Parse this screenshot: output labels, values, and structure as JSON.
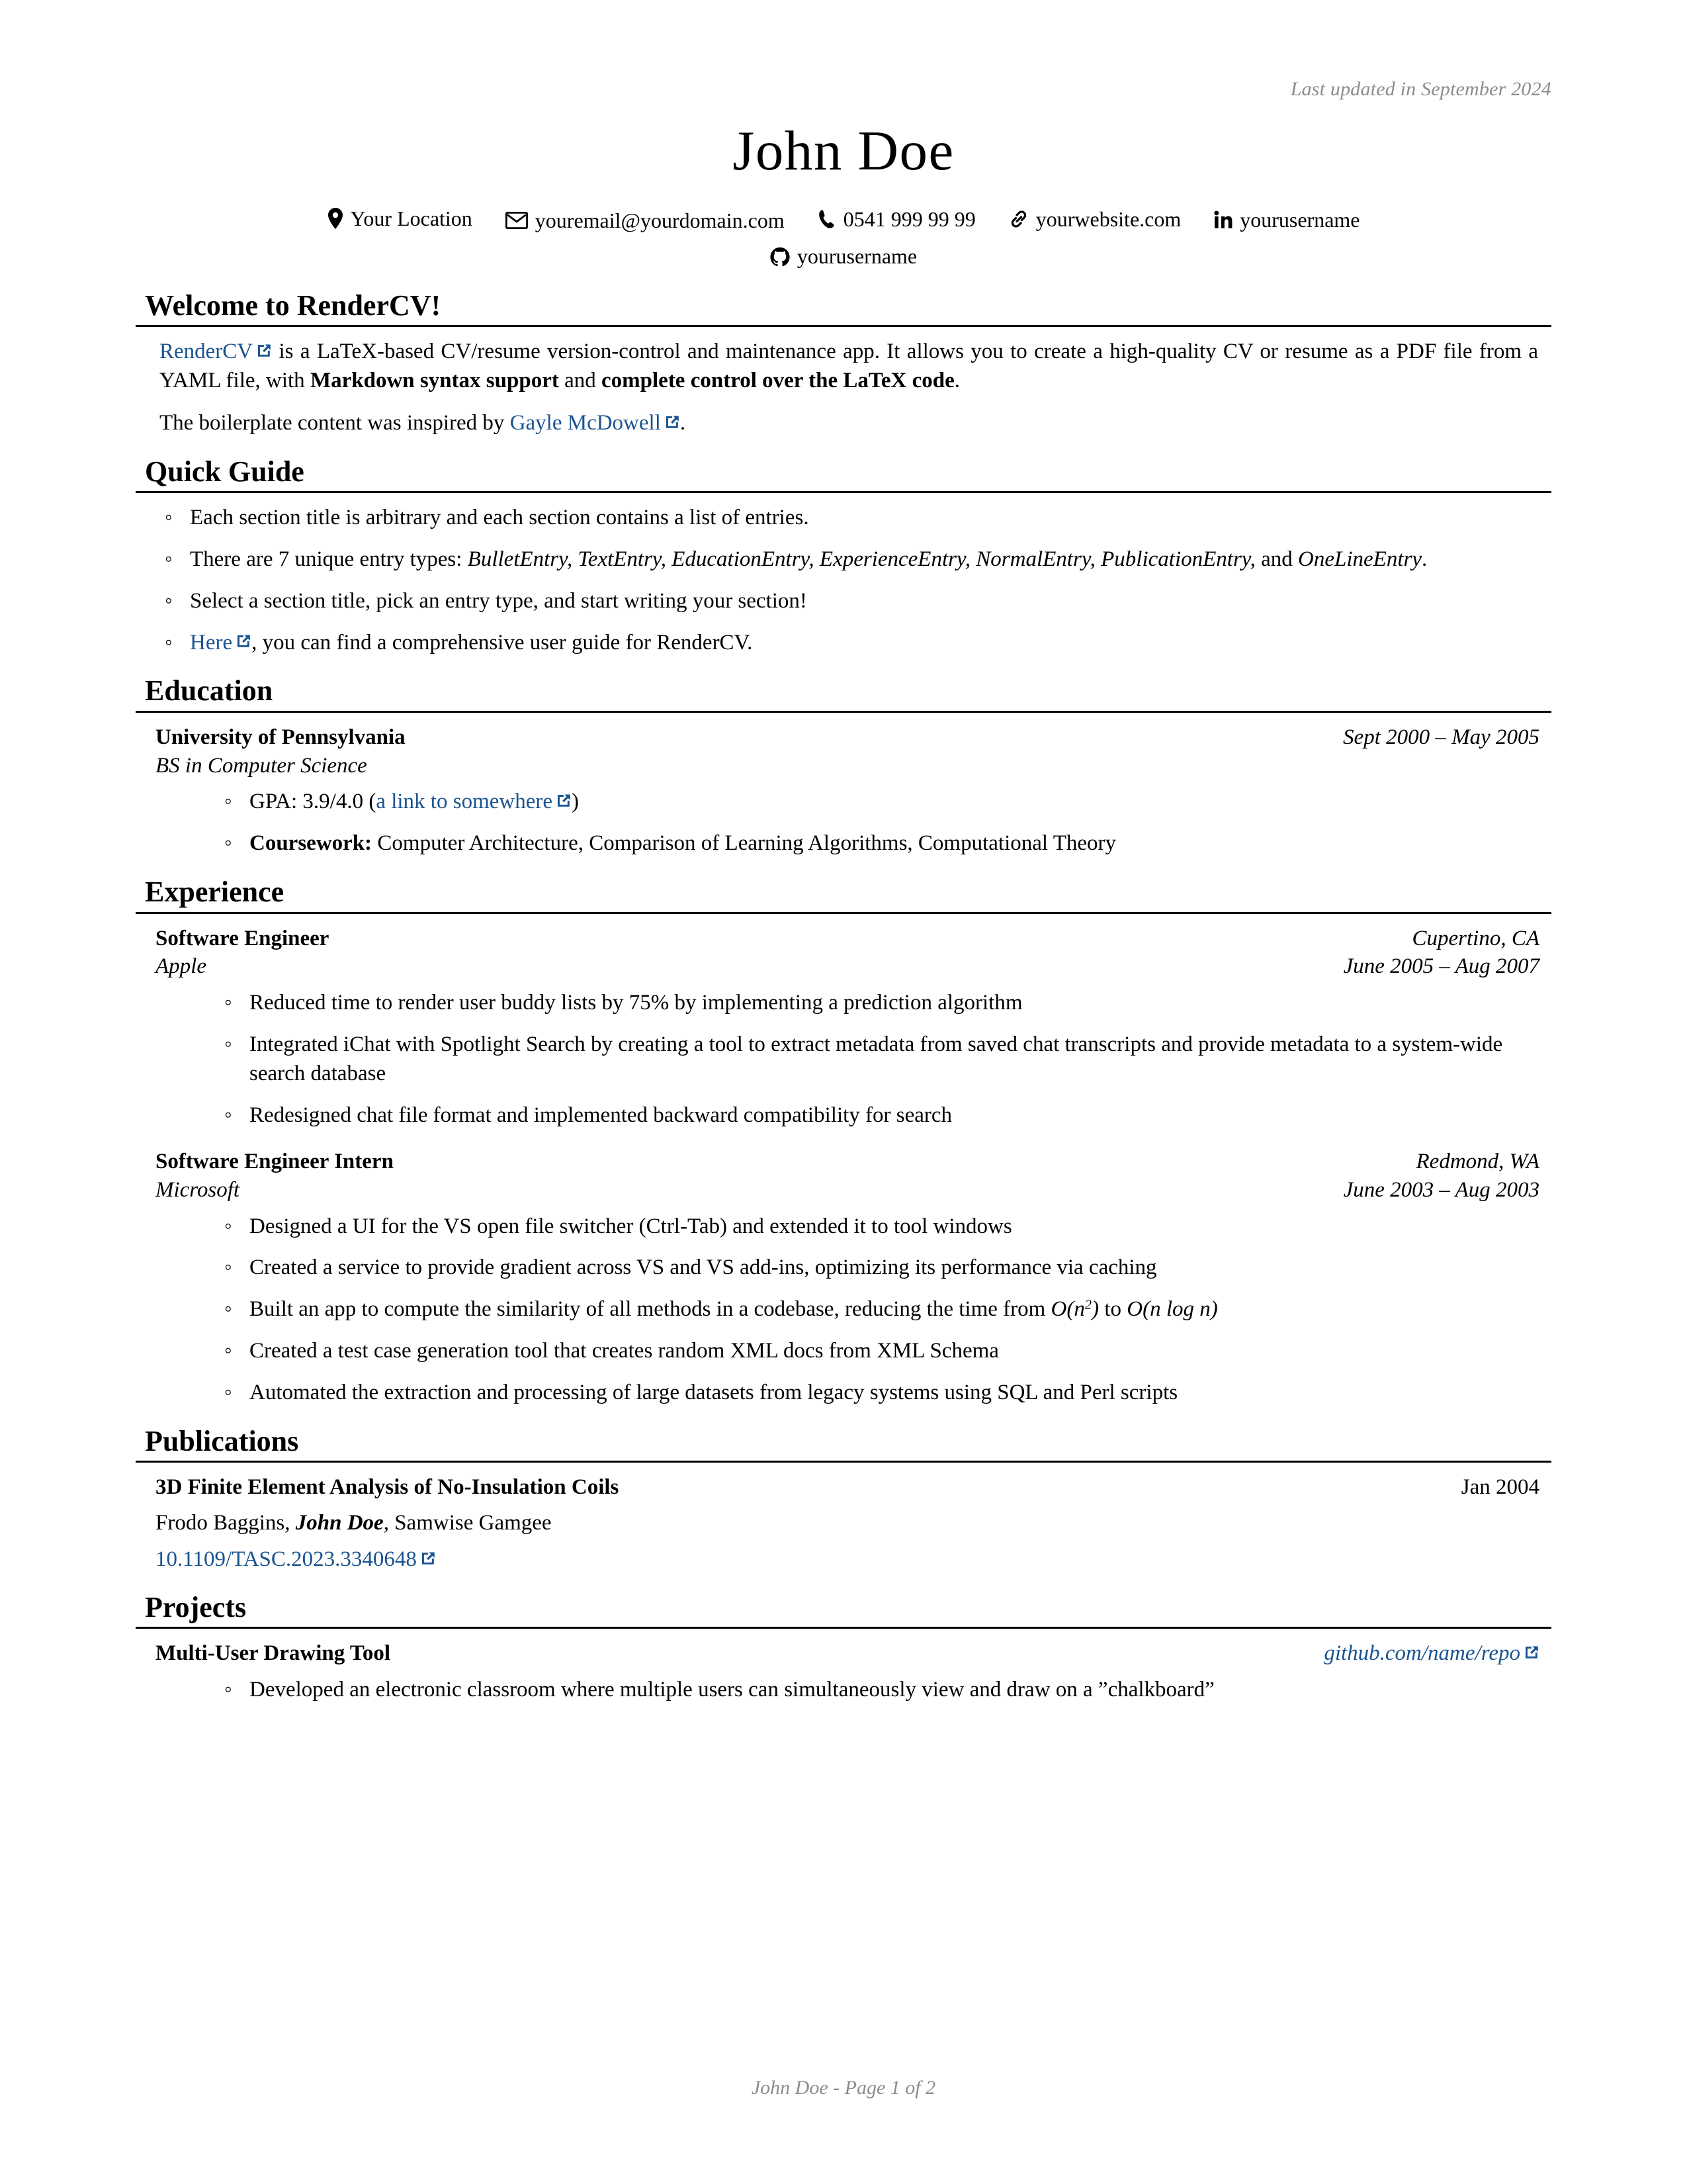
{
  "header": {
    "last_updated": "Last updated in September 2024",
    "name": "John Doe",
    "contacts": [
      {
        "icon": "location-pin-icon",
        "text": "Your Location"
      },
      {
        "icon": "envelope-icon",
        "text": "youremail@yourdomain.com"
      },
      {
        "icon": "phone-icon",
        "text": "0541 999 99 99"
      },
      {
        "icon": "link-icon",
        "text": "yourwebsite.com"
      },
      {
        "icon": "linkedin-icon",
        "text": "yourusername"
      },
      {
        "icon": "github-icon",
        "text": "yourusername"
      }
    ]
  },
  "welcome": {
    "title": "Welcome to RenderCV!",
    "p1_link": "RenderCV",
    "p1_part1": " is a LaTeX-based CV/resume version-control and maintenance app. It allows you to create a high-quality CV or resume as a PDF file from a YAML file, with ",
    "p1_bold1": "Markdown syntax support",
    "p1_part2": " and ",
    "p1_bold2": "complete control over the LaTeX code",
    "p1_part3": ".",
    "p2_part1": "The boilerplate content was inspired by ",
    "p2_link": "Gayle McDowell",
    "p2_part2": "."
  },
  "quick_guide": {
    "title": "Quick Guide",
    "item1": "Each section title is arbitrary and each section contains a list of entries.",
    "item2_part1": "There are 7 unique entry types: ",
    "item2_types": "BulletEntry, TextEntry, EducationEntry, ExperienceEntry, NormalEntry,",
    "item2_types2": "PublicationEntry,",
    "item2_and": " and ",
    "item2_types3": "OneLineEntry",
    "item2_end": ".",
    "item3": "Select a section title, pick an entry type, and start writing your section!",
    "item4_link": "Here",
    "item4_text": ", you can find a comprehensive user guide for RenderCV."
  },
  "education": {
    "title": "Education",
    "entries": [
      {
        "institution": "University of Pennsylvania",
        "dates": "Sept 2000 – May 2005",
        "degree": "BS in Computer Science",
        "gpa_label": "GPA: 3.9/4.0 (",
        "gpa_link": "a link to somewhere",
        "gpa_close": ")",
        "coursework_label": "Coursework:",
        "coursework_text": " Computer Architecture, Comparison of Learning Algorithms, Computational Theory"
      }
    ]
  },
  "experience": {
    "title": "Experience",
    "entries": [
      {
        "position": "Software Engineer",
        "location": "Cupertino, CA",
        "company": "Apple",
        "dates": "June 2005 – Aug 2007",
        "highlights": [
          "Reduced time to render user buddy lists by 75% by implementing a prediction algorithm",
          "Integrated iChat with Spotlight Search by creating a tool to extract metadata from saved chat transcripts and provide metadata to a system-wide search database",
          "Redesigned chat file format and implemented backward compatibility for search"
        ]
      },
      {
        "position": "Software Engineer Intern",
        "location": "Redmond, WA",
        "company": "Microsoft",
        "dates": "June 2003 – Aug 2003",
        "highlights": [
          "Designed a UI for the VS open file switcher (Ctrl-Tab) and extended it to tool windows",
          "Created a service to provide gradient across VS and VS add-ins, optimizing its performance via caching",
          "MATH_BULLET",
          "Created a test case generation tool that creates random XML docs from XML Schema",
          "Automated the extraction and processing of large datasets from legacy systems using SQL and Perl scripts"
        ],
        "math_bullet": {
          "part1": "Built an app to compute the similarity of all methods in a codebase, reducing the time from ",
          "big_o_1": "O(n",
          "exponent": "2",
          "big_o_1_close": ")",
          "part2": " to ",
          "big_o_2": "O(n log n)"
        }
      }
    ]
  },
  "publications": {
    "title": "Publications",
    "entries": [
      {
        "paper_title": "3D Finite Element Analysis of No-Insulation Coils",
        "date": "Jan 2004",
        "authors_before": "Frodo Baggins, ",
        "authors_self": "John Doe",
        "authors_after": ", Samwise Gamgee",
        "doi": "10.1109/TASC.2023.3340648"
      }
    ]
  },
  "projects": {
    "title": "Projects",
    "entries": [
      {
        "project_title": "Multi-User Drawing Tool",
        "url": "github.com/name/repo",
        "highlights": [
          "Developed an electronic classroom where multiple users can simultaneously view and draw on a ”chalkboard”"
        ]
      }
    ]
  },
  "footer": {
    "text": "John Doe - Page 1 of 2"
  },
  "colors": {
    "link": "#1a5490",
    "muted": "#8c8c8c",
    "rule": "#000000"
  }
}
